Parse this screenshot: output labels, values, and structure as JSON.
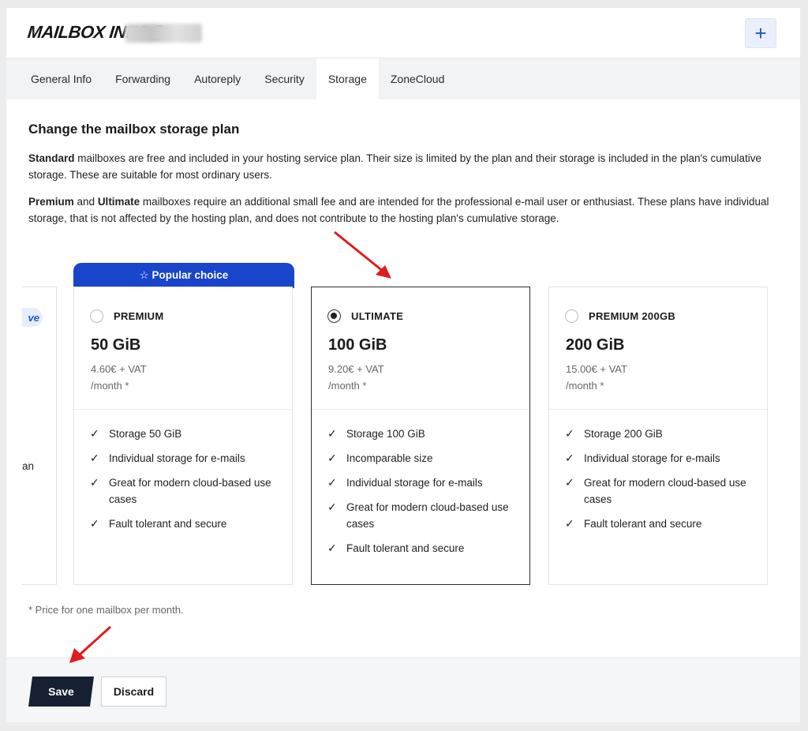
{
  "header": {
    "title": "MAILBOX INFO@",
    "add_label": "+"
  },
  "tabs": [
    {
      "label": "General Info"
    },
    {
      "label": "Forwarding"
    },
    {
      "label": "Autoreply"
    },
    {
      "label": "Security"
    },
    {
      "label": "Storage",
      "active": true
    },
    {
      "label": "ZoneCloud"
    }
  ],
  "content": {
    "title": "Change the mailbox storage plan",
    "para1_bold": "Standard",
    "para1_rest": " mailboxes are free and included in your hosting service plan. Their size is limited by the plan and their storage is included in the plan's cumulative storage. These are suitable for most ordinary users.",
    "para2_bold1": "Premium",
    "para2_and": " and ",
    "para2_bold2": "Ultimate",
    "para2_rest": " mailboxes require an additional small fee and are intended for the professional e-mail user or enthusiast. These plans have individual storage, that is not affected by the hosting plan, and does not contribute to the hosting plan's cumulative storage."
  },
  "partial_card": {
    "pill_text": "ve",
    "feature_fragment": "an"
  },
  "popular_badge": "☆  Popular choice",
  "plans": [
    {
      "name": "PREMIUM",
      "size": "50 GiB",
      "price": "4.60€ + VAT",
      "period": "/month *",
      "selected": false,
      "features": [
        "Storage 50 GiB",
        "Individual storage for e-mails",
        "Great for modern cloud-based use cases",
        "Fault tolerant and secure"
      ]
    },
    {
      "name": "ULTIMATE",
      "size": "100 GiB",
      "price": "9.20€ + VAT",
      "period": "/month *",
      "selected": true,
      "features": [
        "Storage 100 GiB",
        "Incomparable size",
        "Individual storage for e-mails",
        "Great for modern cloud-based use cases",
        "Fault tolerant and secure"
      ]
    },
    {
      "name": "PREMIUM 200GB",
      "size": "200 GiB",
      "price": "15.00€ + VAT",
      "period": "/month *",
      "selected": false,
      "features": [
        "Storage 200 GiB",
        "Individual storage for e-mails",
        "Great for modern cloud-based use cases",
        "Fault tolerant and secure"
      ]
    }
  ],
  "check_glyph": "✓",
  "footnote": "* Price for one mailbox per month.",
  "footer": {
    "save_label": "Save",
    "discard_label": "Discard"
  },
  "colors": {
    "accent": "#1845cc",
    "dark_button": "#172033",
    "annotation_arrow": "#e21b1b"
  }
}
